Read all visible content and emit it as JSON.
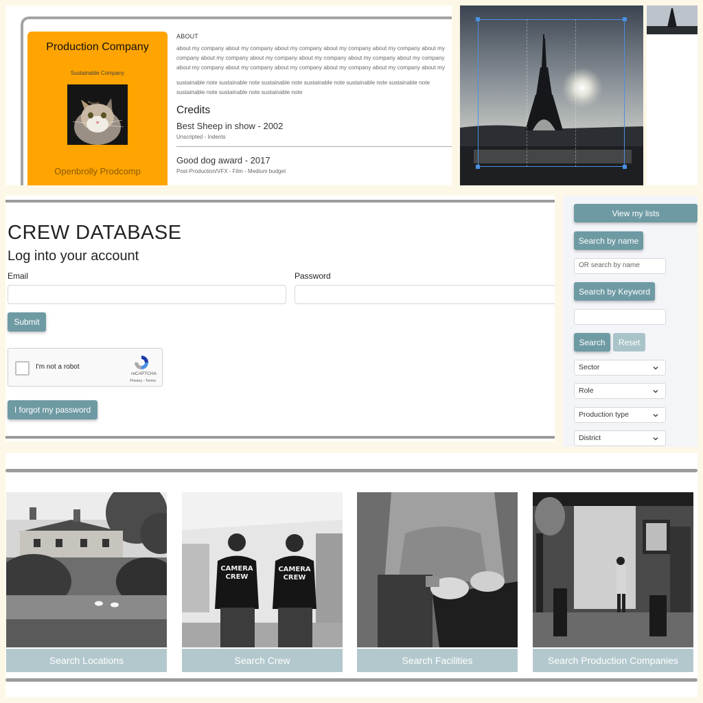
{
  "company": {
    "name": "Production Company",
    "tagline": "Sustainable Company",
    "footer_name": "Openbrolly Prodcomp",
    "about_heading": "ABOUT",
    "about_text": "about my company about my company about my company about my company about my company about my company about my company about my company about my company about my company about my company about my company about my company about my company about my company about my company about my company about my company about my company about my company about my company about my company about my company",
    "sustainable_text": "sustainable note sustainable note sustainable note sustainable note sustainable note sustainable note sustainable note sustainable note sustainable note",
    "credits_heading": "Credits",
    "credits": [
      {
        "title": "Best Sheep in show - 2002",
        "meta": "Unscripted - Indents"
      },
      {
        "title": "Good dog award - 2017",
        "meta": "Post-Production/VFX - Film - Medium budget"
      }
    ]
  },
  "login": {
    "title": "CREW DATABASE",
    "subtitle": "Log into your account",
    "email_label": "Email",
    "password_label": "Password",
    "submit_label": "Submit",
    "captcha_label": "I'm not a robot",
    "captcha_brand": "reCAPTCHA",
    "captcha_links": "Privacy - Terms",
    "forgot_label": "I forgot my password"
  },
  "sidebar": {
    "view_lists_label": "View my lists",
    "search_name_label": "Search by name",
    "name_placeholder": "OR search by name",
    "search_keyword_label": "Search by Keyword",
    "keyword_value": "",
    "search_label": "Search",
    "reset_label": "Reset",
    "filters": [
      "Sector",
      "Role",
      "Production type",
      "District"
    ]
  },
  "tiles": [
    {
      "label": "Search Locations",
      "image": "countryside-house-pond"
    },
    {
      "label": "Search Crew",
      "image": "camera-crew-walking"
    },
    {
      "label": "Search Facilities",
      "image": "laptop-hands"
    },
    {
      "label": "Search Production Companies",
      "image": "studio-equipment"
    }
  ],
  "colors": {
    "accent": "#6e9aa3",
    "accent_light": "#b3c8cd",
    "card": "#ffa400",
    "page_bg": "#fdf7e7",
    "sidebar_bg": "#f4f5f9"
  }
}
